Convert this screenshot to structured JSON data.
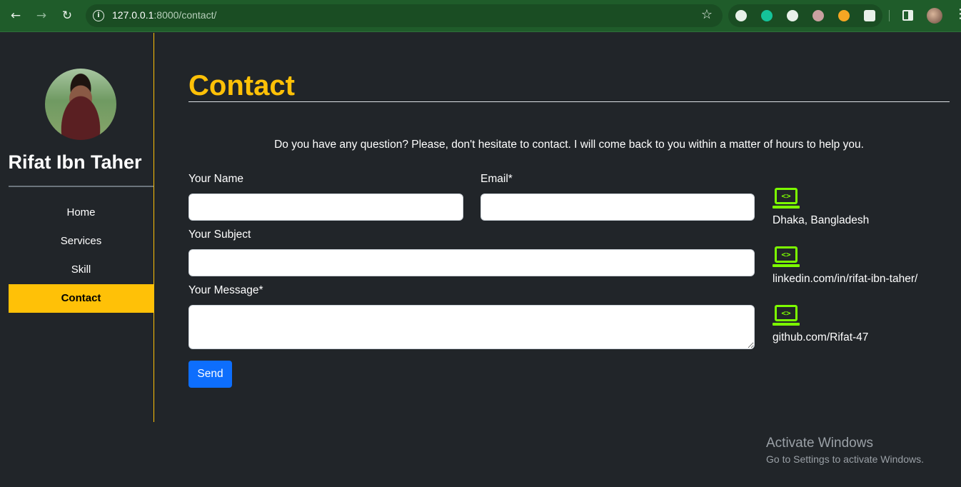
{
  "browser": {
    "url_host": "127.0.0.1",
    "url_path": ":8000/contact/",
    "back_icon": "←",
    "forward_icon": "→",
    "reload_icon": "↻",
    "info_icon": "i",
    "star_icon": "☆",
    "menu_icon": "⋮",
    "extension_colors": [
      "#e8f0e9",
      "#15c39a",
      "#e8f0e9",
      "#c9a0a0",
      "#f5a623",
      "#e8f0e9"
    ]
  },
  "sidebar": {
    "name": "Rifat Ibn Taher",
    "menu": [
      {
        "label": "Home",
        "active": false
      },
      {
        "label": "Services",
        "active": false
      },
      {
        "label": "Skill",
        "active": false
      },
      {
        "label": "Contact",
        "active": true
      }
    ]
  },
  "main": {
    "title": "Contact",
    "intro": "Do you have any question? Please, don't hesitate to contact. I will come back to you within a matter of hours to help you.",
    "form": {
      "name_label": "Your Name",
      "email_label": "Email*",
      "subject_label": "Your Subject",
      "message_label": "Your Message*",
      "name_value": "",
      "email_value": "",
      "subject_value": "",
      "message_value": "",
      "send_label": "Send"
    },
    "contacts": [
      {
        "icon": "laptop-code-icon",
        "icon_glyph": "<>",
        "text": "Dhaka, Bangladesh"
      },
      {
        "icon": "laptop-code-icon",
        "icon_glyph": "<>",
        "text": "linkedin.com/in/rifat-ibn-taher/"
      },
      {
        "icon": "laptop-code-icon",
        "icon_glyph": "<>",
        "text": "github.com/Rifat-47"
      }
    ]
  },
  "watermark": {
    "title": "Activate Windows",
    "subtitle": "Go to Settings to activate Windows."
  },
  "colors": {
    "accent": "#ffc107",
    "icon_green": "#7cfc00",
    "button_blue": "#0d6efd",
    "background": "#212529",
    "chrome_green": "#1f5c2a"
  }
}
